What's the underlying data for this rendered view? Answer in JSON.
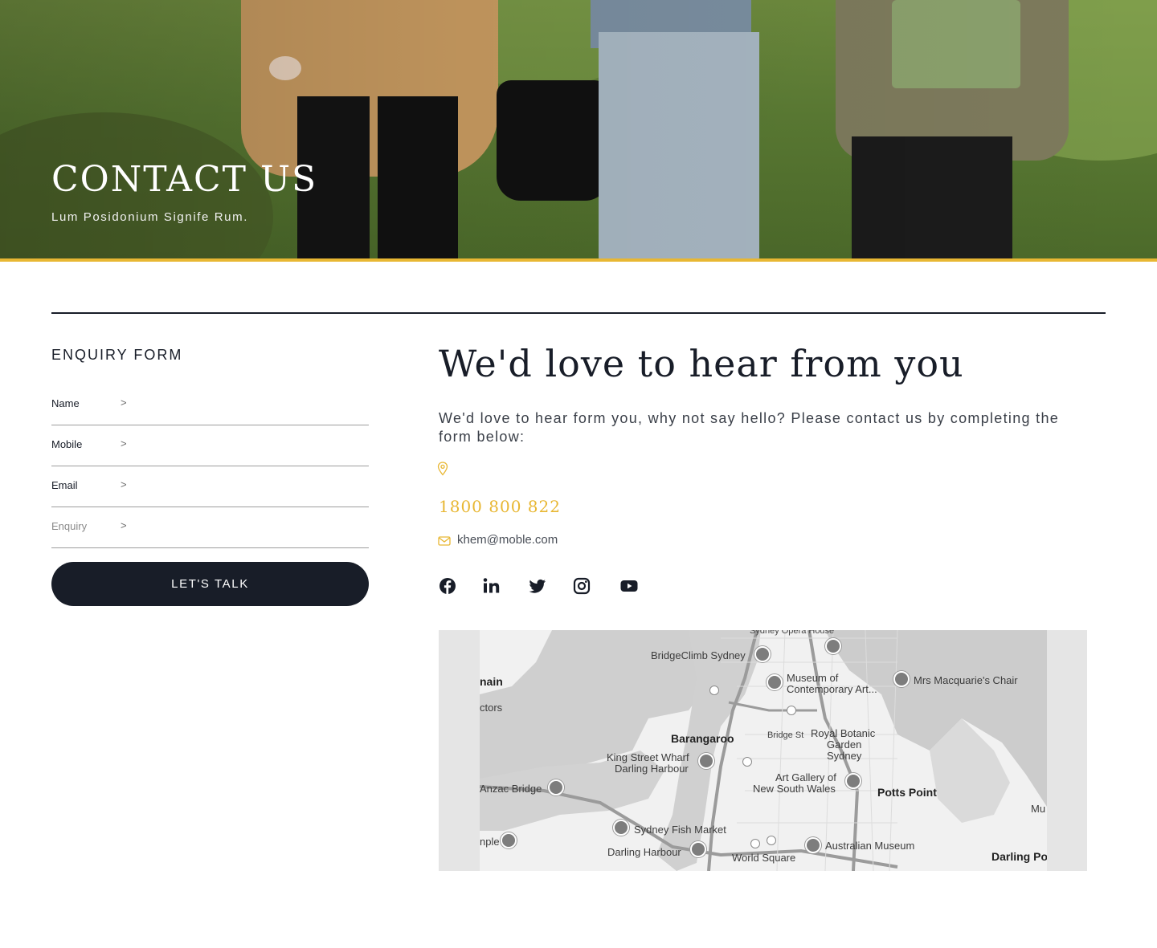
{
  "hero": {
    "title": "CONTACT US",
    "subtitle": "Lum Posidonium Signife Rum."
  },
  "form": {
    "title": "ENQUIRY FORM",
    "fields": [
      {
        "label": "Name",
        "arrow": ">"
      },
      {
        "label": "Mobile",
        "arrow": ">"
      },
      {
        "label": "Email",
        "arrow": ">"
      },
      {
        "label": "Enquiry",
        "arrow": ">"
      }
    ],
    "submit_label": "LET'S TALK"
  },
  "contact": {
    "heading": "We'd love to hear from you",
    "intro": "We'd love to hear form you, why not say hello? Please contact us by completing the form below:",
    "phone": "1800 800 822",
    "email": "khem@moble.com",
    "pin_icon": "location-pin-icon",
    "mail_icon": "envelope-icon",
    "accent_color": "#e8b733"
  },
  "social": [
    {
      "name": "facebook-icon"
    },
    {
      "name": "linkedin-icon"
    },
    {
      "name": "twitter-icon"
    },
    {
      "name": "instagram-icon"
    },
    {
      "name": "youtube-icon"
    }
  ],
  "map": {
    "labels": {
      "opera_house": "Sydney Opera House",
      "bridgeclimb": "BridgeClimb Sydney",
      "museum1": "Museum of",
      "museum2": "Contemporary Art...",
      "macquarie": "Mrs Macquarie's Chair",
      "domain": "nain",
      "ctors": "ctors",
      "barangaroo": "Barangaroo",
      "bridge_st": "Bridge St",
      "botanic1": "Royal Botanic",
      "botanic2": "Garden",
      "botanic3": "Sydney",
      "kingst1": "King Street Wharf",
      "kingst2": "Darling Harbour",
      "artgallery1": "Art Gallery of",
      "artgallery2": "New South Wales",
      "anzac": "Anzac Bridge",
      "potts": "Potts Point",
      "mu": "Mu",
      "fishmarket": "Sydney Fish Market",
      "temple": "nple",
      "darling_harbour": "Darling Harbour",
      "australian_museum": "Australian Museum",
      "world_square": "World Square",
      "darling_point": "Darling Po"
    }
  }
}
